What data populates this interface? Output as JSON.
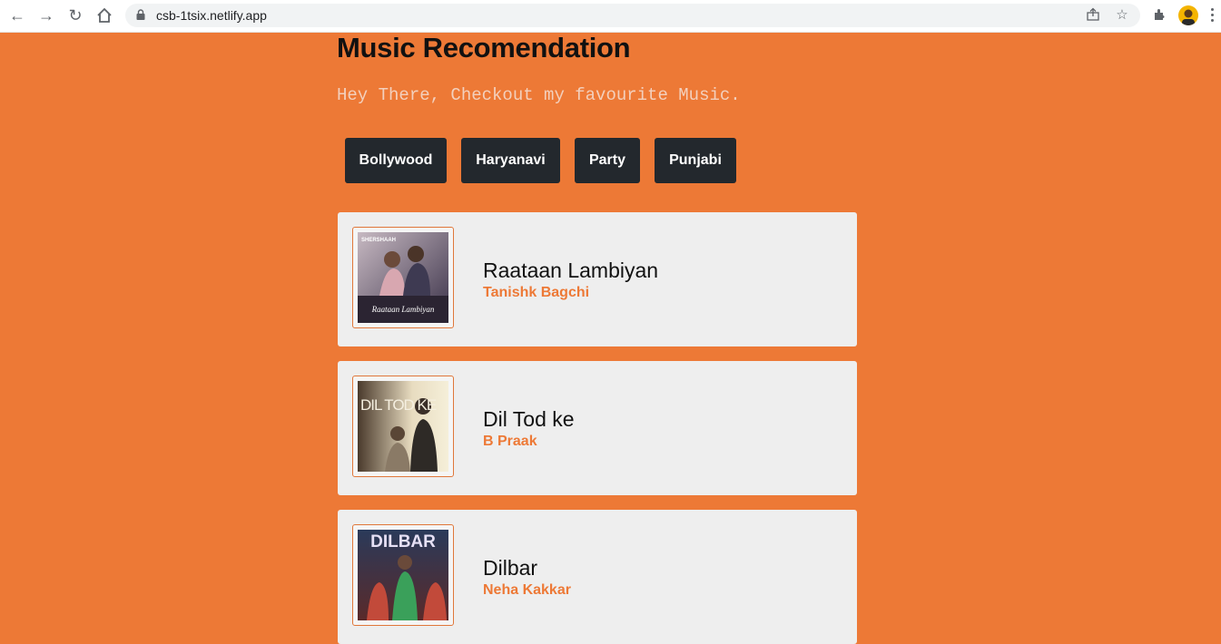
{
  "browser": {
    "url": "csb-1tsix.netlify.app",
    "icons": [
      "back-icon",
      "forward-icon",
      "reload-icon",
      "home-icon",
      "lock-icon",
      "share-icon",
      "star-icon",
      "extensions-icon",
      "avatar",
      "menu-icon"
    ]
  },
  "page": {
    "title": "Music Recomendation",
    "subtitle": "Hey There, Checkout my favourite Music."
  },
  "genres": [
    {
      "label": "Bollywood"
    },
    {
      "label": "Haryanavi"
    },
    {
      "label": "Party"
    },
    {
      "label": "Punjabi"
    }
  ],
  "songs": [
    {
      "name": "Raataan Lambiyan",
      "artist": "Tanishk Bagchi",
      "cover_text": "Raataan Lambiyan",
      "cover_label": "SHERSHAAH"
    },
    {
      "name": "Dil Tod ke",
      "artist": "B Praak",
      "cover_text": "DIL TOD KE"
    },
    {
      "name": "Dilbar",
      "artist": "Neha Kakkar",
      "cover_text": "DILBAR"
    }
  ],
  "colors": {
    "background": "#ED7936",
    "button": "#23282d",
    "card": "#eeeeee",
    "accent": "#ED7936"
  }
}
